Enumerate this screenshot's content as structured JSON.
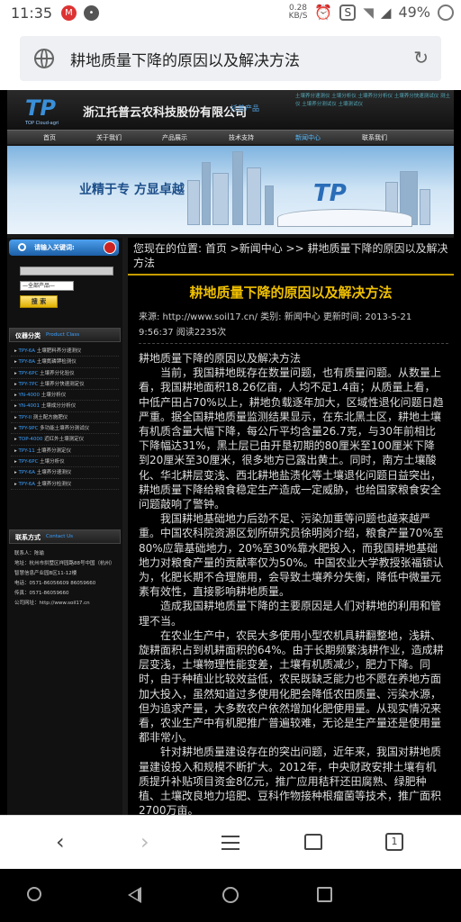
{
  "status": {
    "time": "11:35",
    "speed_value": "0.28",
    "speed_unit": "KB/S",
    "battery": "49%",
    "icons": [
      "mcdonalds-icon",
      "chat-icon",
      "alarm-icon",
      "s-app-icon",
      "wifi-icon",
      "signal-icon",
      "battery-icon"
    ]
  },
  "browser": {
    "page_title": "耕地质量下降的原因以及解决方法",
    "reload_icon": "↻"
  },
  "site": {
    "logo": "TP",
    "logo_sub": "TOP Cloud-agri",
    "company": "浙江托普云农科技股份有限公司",
    "header_tag": "托普产品",
    "header_links": "土壤养分速测仪 土壤分析仪 土壤养分分析仪 土壤养分快速测试仪 测土仪 土壤养分测试仪 土壤测试仪",
    "nav": [
      "首页",
      "关于我们",
      "产品展示",
      "技术支持",
      "新闻中心",
      "联系我们"
    ],
    "banner_slogan": "业精于专  方显卓越"
  },
  "sidebar": {
    "search_label": "请输入关键词:",
    "select_value": "—全部产品—",
    "search_button": "搜 索",
    "products_title": "仪器分类",
    "products_title_en": "Product Class",
    "products": [
      {
        "code": "TPY-6A",
        "name": "土壤肥料养分速测仪"
      },
      {
        "code": "TPY-8A",
        "name": "土壤氮磷钾检测仪"
      },
      {
        "code": "TPY-6PC",
        "name": "土壤养分化验仪"
      },
      {
        "code": "TPY-7PC",
        "name": "土壤养分快速测定仪"
      },
      {
        "code": "YN-4000",
        "name": "土壤分析仪"
      },
      {
        "code": "YN-4001",
        "name": "土壤成分分析仪"
      },
      {
        "code": "TPY-II",
        "name": "测土配方施肥仪"
      },
      {
        "code": "TPY-9PC",
        "name": "多功能土壤养分测试仪"
      },
      {
        "code": "TOP-4000",
        "name": "近红外土壤测定仪"
      },
      {
        "code": "TPY-11",
        "name": "土壤养分测定仪"
      },
      {
        "code": "TPY-6PC",
        "name": "土壤分析仪"
      },
      {
        "code": "TPY-6A",
        "name": "土壤养分速测仪"
      },
      {
        "code": "TPY-6A",
        "name": "土壤养分检测仪"
      }
    ],
    "contact_title": "联系方式",
    "contact_title_en": "Contact Us",
    "contact_lines": [
      "联系人：陈瑜",
      "地址：杭州市拱墅区祥园路88号中国（杭州）智慧信息产业园B区11-12楼",
      "电话：0571-86056609 86059660",
      "传真：0571-86059660",
      "公司网址：http://www.soil17.cn"
    ]
  },
  "article": {
    "breadcrumb": "您现在的位置: 首页 >新闻中心 >> 耕地质量下降的原因以及解决方法",
    "title": "耕地质量下降的原因以及解决方法",
    "meta": "来源: http://www.soil17.cn/    类别: 新闻中心    更新时间: 2013-5-21 9:56:37    阅读2235次",
    "paragraphs": [
      "耕地质量下降的原因以及解决方法",
      "当前，我国耕地既存在数量问题，也有质量问题。从数量上看，我国耕地面积18.26亿亩，人均不足1.4亩；从质量上看，中低产田占70%以上，耕地负载逐年加大，区域性退化问题日趋严重。据全国耕地质量监测结果显示，在东北黑土区，耕地土壤有机质含量大幅下降，每公斤平均含量26.7克，与30年前相比下降幅达31%，黑土层已由开垦初期的80厘米至100厘米下降到20厘米至30厘米，很多地方已露出黄土。同时，南方土壤酸化、华北耕层变浅、西北耕地盐渍化等土壤退化问题日益突出，耕地质量下降给粮食稳定生产造成一定威胁，也给国家粮食安全问题敲响了警钟。",
      "我国耕地基础地力后劲不足、污染加重等问题也越来越严重。中国农科院资源区划所研究员徐明岗介绍，粮食产量70%至80%应靠基础地力，20%至30%靠水肥投入，而我国耕地基础地力对粮食产量的贡献率仅为50%。中国农业大学教授张福锁认为，化肥长期不合理施用，会导致土壤养分失衡，降低中微量元素有效性，直接影响耕地质量。",
      "造成我国耕地质量下降的主要原因是人们对耕地的利用和管理不当。",
      "在农业生产中，农民大多使用小型农机具耕翻整地，浅耕、旋耕面积占到机耕面积的64%。由于长期频繁浅耕作业，造成耕层变浅，土壤物理性能变差，土壤有机质减少，肥力下降。同时，由于种植业比较效益低，农民既缺乏能力也不愿在养地方面加大投入，虽然知道过多使用化肥会降低农田质量、污染水源，但为追求产量，大多数农户依然增加化肥使用量。从现实情况来看，农业生产中有机肥推广普遍较难，无论是生产量还是使用量都非常小。",
      "针对耕地质量建设存在的突出问题，近年来，我国对耕地质量建设投入和规模不断扩大。2012年，中央财政安排土壤有机质提升补贴项目资金8亿元，推广应用秸秆还田腐熟、绿肥种植、土壤改良地力培肥、豆科作物接种根瘤菌等技术，推广面积2700万亩。"
    ]
  },
  "bottom_nav": {
    "tab_count": "1"
  }
}
